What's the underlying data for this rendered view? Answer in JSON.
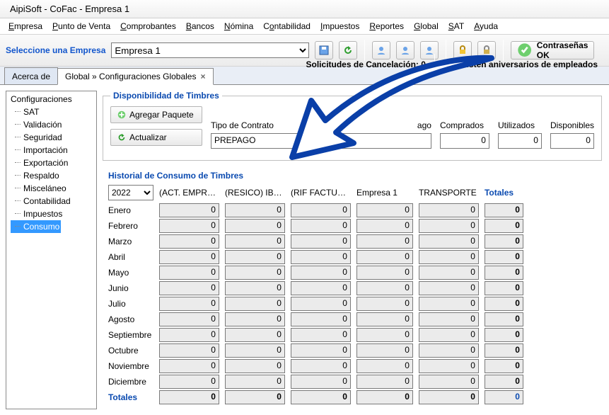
{
  "window": {
    "title": "AipiSoft - CoFac - Empresa 1"
  },
  "menu": [
    "Empresa",
    "Punto de Venta",
    "Comprobantes",
    "Bancos",
    "Nómina",
    "Contabilidad",
    "Impuestos",
    "Reportes",
    "Global",
    "SAT",
    "Ayuda"
  ],
  "toolbar": {
    "select_label": "Seleccione una Empresa",
    "company_options": [
      "Empresa 1"
    ],
    "company_selected": "Empresa 1",
    "passwords_ok": "Contraseñas OK",
    "cancel_status": "Solicitudes de Cancelación: 0",
    "anniv_status": "No existen aniversarios de empleados"
  },
  "tabs": {
    "inactive": "Acerca de",
    "active": "Global » Configuraciones Globales"
  },
  "tree": {
    "root": "Configuraciones",
    "items": [
      "SAT",
      "Validación",
      "Seguridad",
      "Importación",
      "Exportación",
      "Respaldo",
      "Misceláneo",
      "Contabilidad",
      "Impuestos",
      "Consumo"
    ],
    "selected_index": 9
  },
  "disp": {
    "legend": "Disponibilidad de Timbres",
    "btn_add": "Agregar Paquete",
    "btn_refresh": "Actualizar",
    "lbl_contract": "Tipo de Contrato",
    "contract_value": "PREPAGO",
    "lbl_pay": "ago",
    "pay_value": "",
    "lbl_bought": "Comprados",
    "bought_value": "0",
    "lbl_used": "Utilizados",
    "used_value": "0",
    "lbl_avail": "Disponibles",
    "avail_value": "0"
  },
  "history": {
    "title": "Historial de Consumo de Timbres",
    "year": "2022",
    "columns": [
      "(ACT. EMPRES...",
      "(RESICO) IBAR...",
      "(RIF FACTURA...",
      "Empresa 1",
      "TRANSPORTE"
    ],
    "totals_label": "Totales",
    "months": [
      "Enero",
      "Febrero",
      "Marzo",
      "Abril",
      "Mayo",
      "Junio",
      "Julio",
      "Agosto",
      "Septiembre",
      "Octubre",
      "Noviembre",
      "Diciembre"
    ],
    "cells_value": "0",
    "row_total": "0",
    "bottom_totals": [
      "0",
      "0",
      "0",
      "0",
      "0"
    ],
    "grand_total": "0"
  }
}
